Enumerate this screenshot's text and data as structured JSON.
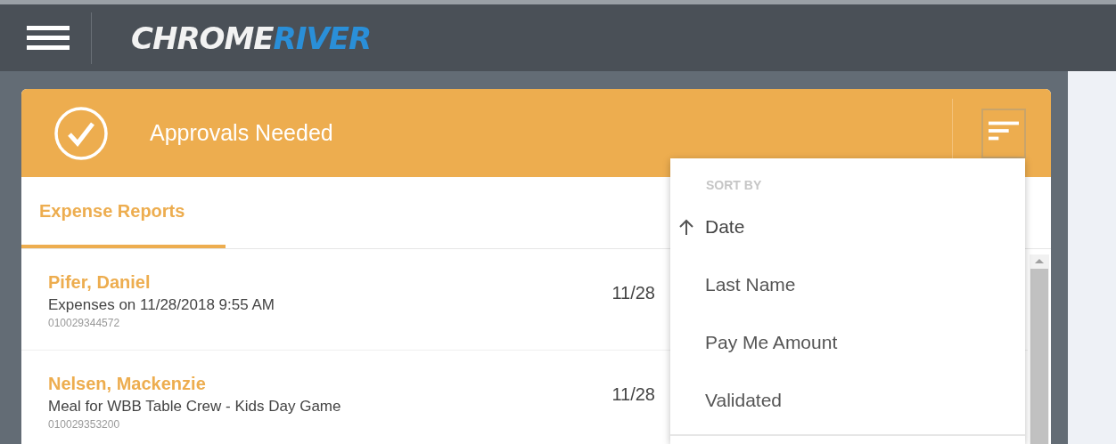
{
  "logo": {
    "part_1": "CHROME",
    "part_2": "RIVER"
  },
  "header": {
    "title": "Approvals Needed"
  },
  "tabs": [
    {
      "label": "Expense Reports",
      "selected": true
    }
  ],
  "reports": [
    {
      "name": "Pifer, Daniel",
      "description": "Expenses on 11/28/2018 9:55 AM",
      "number": "010029344572",
      "date": "11/28"
    },
    {
      "name": "Nelsen, Mackenzie",
      "description": "Meal for WBB Table Crew - Kids Day Game",
      "number": "010029353200",
      "date": "11/28"
    }
  ],
  "sort_menu": {
    "heading": "SORT BY",
    "items": [
      {
        "label": "Date",
        "selected": true
      },
      {
        "label": "Last Name",
        "selected": false
      },
      {
        "label": "Pay Me Amount",
        "selected": false
      },
      {
        "label": "Validated",
        "selected": false
      }
    ]
  }
}
